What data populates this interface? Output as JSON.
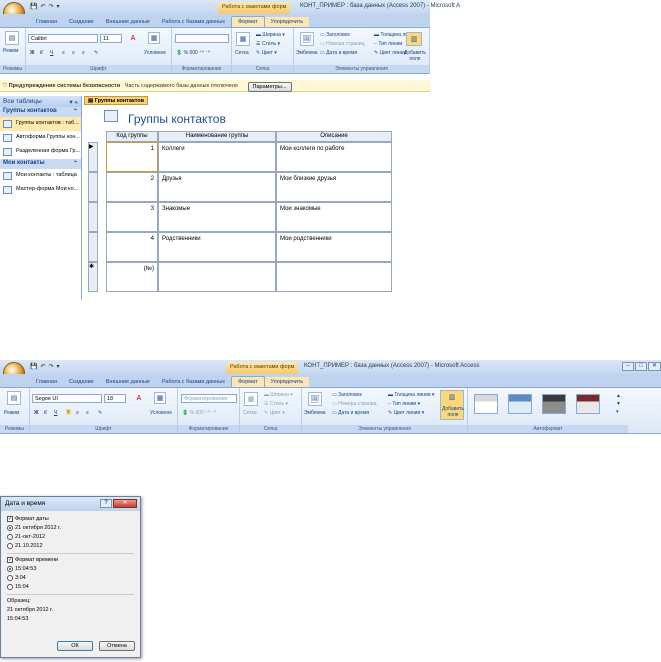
{
  "top": {
    "context_tab": "Работа с макетами форм",
    "window_title": "КОНТ_ПРИМЕР : база данных (Access 2007) - Microsoft A",
    "qat": [
      "💾",
      "↶",
      "↷",
      "▾"
    ],
    "tabs": [
      "Главная",
      "Создание",
      "Внешние данные",
      "Работа с базами данных",
      "Формат",
      "Упорядочить"
    ],
    "active_tab": "Формат",
    "ribbon": {
      "mode_label": "Режим",
      "font_name": "Calibri",
      "font_size": "11",
      "cond_label": "Условное",
      "grid_label": "Сетка",
      "width_label": "Ширина",
      "style_label": "Стиль",
      "color_label": "Цвет",
      "emblem_label": "Эмблема",
      "header_label": "Заголовок",
      "pagenum_label": "Номера страниц",
      "datetime_label": "Дата и время",
      "linewidth_label": "Толщина линии",
      "linetype_label": "Тип линии",
      "linecolor_label": "Цвет линии",
      "addfields_label": "Добавить поля",
      "groups": [
        "Режимы",
        "Шрифт",
        "Форматирование",
        "Сетка",
        "Элементы управления"
      ]
    },
    "security": {
      "title": "Предупреждение системы безопасности",
      "text": "Часть содержимого базы данных отключено",
      "button": "Параметры..."
    },
    "nav": {
      "header": "Все таблицы",
      "groups": [
        {
          "name": "Группы контактов",
          "items": [
            "Группы контактов : таб...",
            "Автоформа Группы кон...",
            "Разделенная форма Гр..."
          ]
        },
        {
          "name": "Мои контакты",
          "items": [
            "Мои контакты : таблица",
            "Мастер-форма Мои ко..."
          ]
        }
      ]
    },
    "doc_tab": "Группы контактов",
    "form_title": "Группы контактов",
    "columns": [
      "Код группы",
      "Наименование группы",
      "Описание"
    ],
    "rows": [
      {
        "code": "1",
        "name": "Коллеги",
        "desc": "Мои коллеги по работе"
      },
      {
        "code": "2",
        "name": "Друзья",
        "desc": "Мои близкие друзья"
      },
      {
        "code": "3",
        "name": "Знакомые",
        "desc": "Мои знакомые"
      },
      {
        "code": "4",
        "name": "Родственники",
        "desc": "Мои родственники"
      },
      {
        "code": "(№)",
        "name": "",
        "desc": ""
      }
    ]
  },
  "middle": {
    "context_tab": "Работа с макетами форм",
    "window_title": "КОНТ_ПРИМЕР : база данных (Access 2007) - Microsoft Access",
    "tabs": [
      "Главная",
      "Создание",
      "Внешние данные",
      "Работа с базами данных",
      "Формат",
      "Упорядочить"
    ],
    "active_tab": "Формат",
    "ribbon": {
      "mode_label": "Режим",
      "font_name": "Segoe UI",
      "font_size": "18",
      "cond_label": "Условное",
      "format_combo": "Форматирование",
      "grid_label": "Сетка",
      "width_label": "Ширина",
      "style_label": "Стиль",
      "color_label": "Цвет",
      "emblem_label": "Эмблема",
      "header_label": "Заголовок",
      "pagenum_label": "Номера страниц",
      "datetime_label": "Дата и время",
      "linewidth_label": "Толщина линии",
      "linetype_label": "Тип линии",
      "linecolor_label": "Цвет линии",
      "addfields_label": "Добавить поля",
      "groups": [
        "Режимы",
        "Шрифт",
        "Форматирование",
        "Сетка",
        "Элементы управления",
        "Автоформат"
      ]
    }
  },
  "dialog": {
    "title": "Дата и время",
    "date_check": "Формат даты",
    "date_options": [
      "21 октября 2012 г.",
      "21-окт-2012",
      "21.10.2012"
    ],
    "time_check": "Формат времени",
    "time_options": [
      "15:04:53",
      "3:04",
      "15:04"
    ],
    "sample_label": "Образец:",
    "sample_lines": [
      "21 октября 2012 г.",
      "15:04:53"
    ],
    "ok": "ОК",
    "cancel": "Отмена"
  }
}
